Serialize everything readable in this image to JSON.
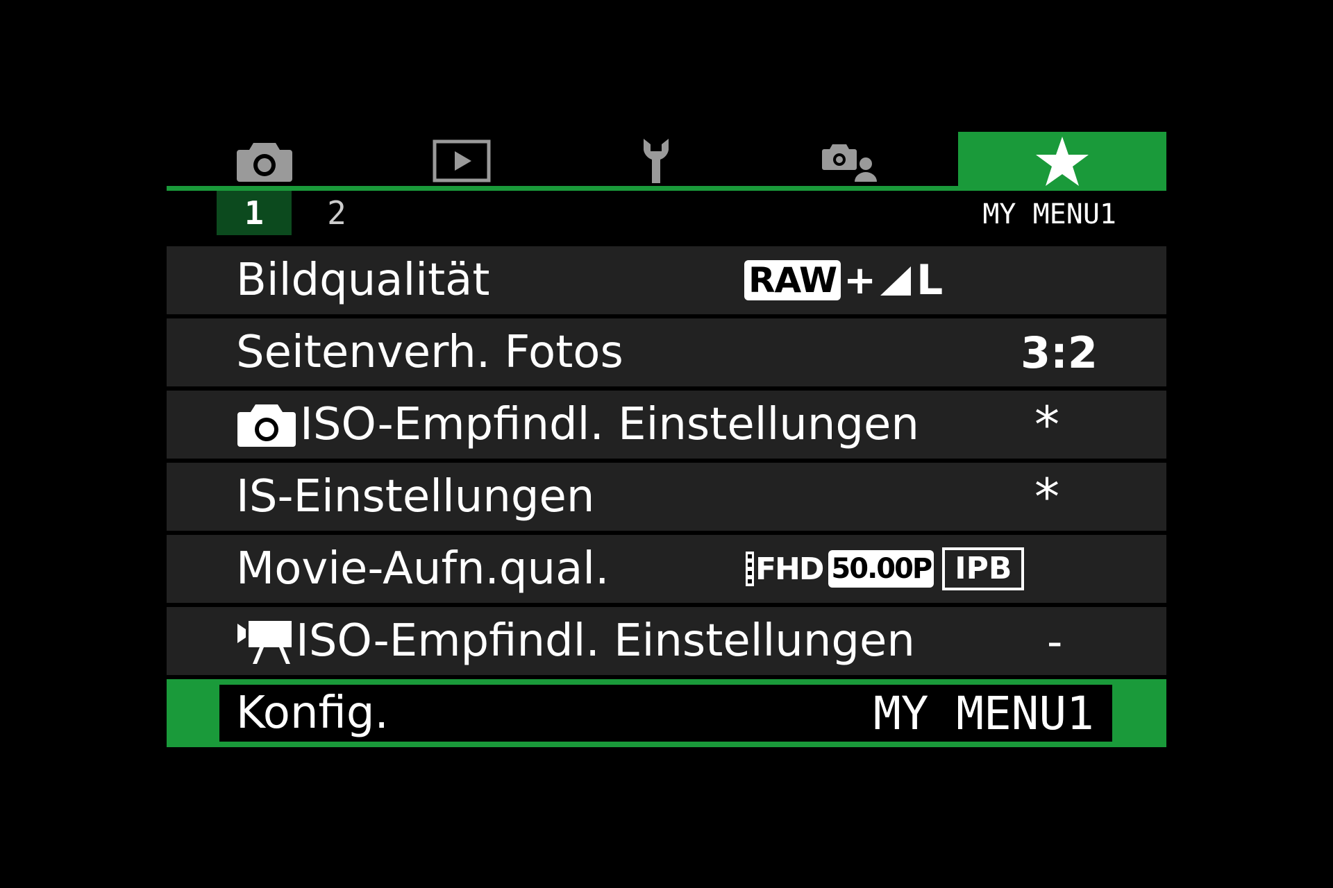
{
  "colors": {
    "accent": "#1a9a3a",
    "row_bg": "#222222",
    "page_tab_active": "#0c4a1e"
  },
  "tabs": [
    {
      "icon": "camera-icon",
      "active": false
    },
    {
      "icon": "playback-icon",
      "active": false
    },
    {
      "icon": "wrench-icon",
      "active": false
    },
    {
      "icon": "custom-functions-icon",
      "active": false
    },
    {
      "icon": "star-icon",
      "active": true
    }
  ],
  "pages": [
    {
      "label": "1",
      "active": true
    },
    {
      "label": "2",
      "active": false
    }
  ],
  "menu_name": "MY MENU1",
  "rows": [
    {
      "label": "Bildqualität",
      "value": {
        "raw": "RAW",
        "plus": "+",
        "size": "L"
      }
    },
    {
      "label": "Seitenverh. Fotos",
      "value": "3:2"
    },
    {
      "label_icon": "photo-camera-icon",
      "label": "ISO-Empfindl. Einstellungen",
      "value": "*"
    },
    {
      "label": "IS-Einstellungen",
      "value": "*"
    },
    {
      "label": "Movie-Aufn.qual.",
      "value": {
        "res": "FHD",
        "fps": "50.00P",
        "comp": "IPB"
      }
    },
    {
      "label_icon": "movie-camera-icon",
      "label": "ISO-Empfindl. Einstellungen",
      "value": "-"
    },
    {
      "label": "Konfig.",
      "value": "MY MENU1",
      "selected": true
    }
  ]
}
